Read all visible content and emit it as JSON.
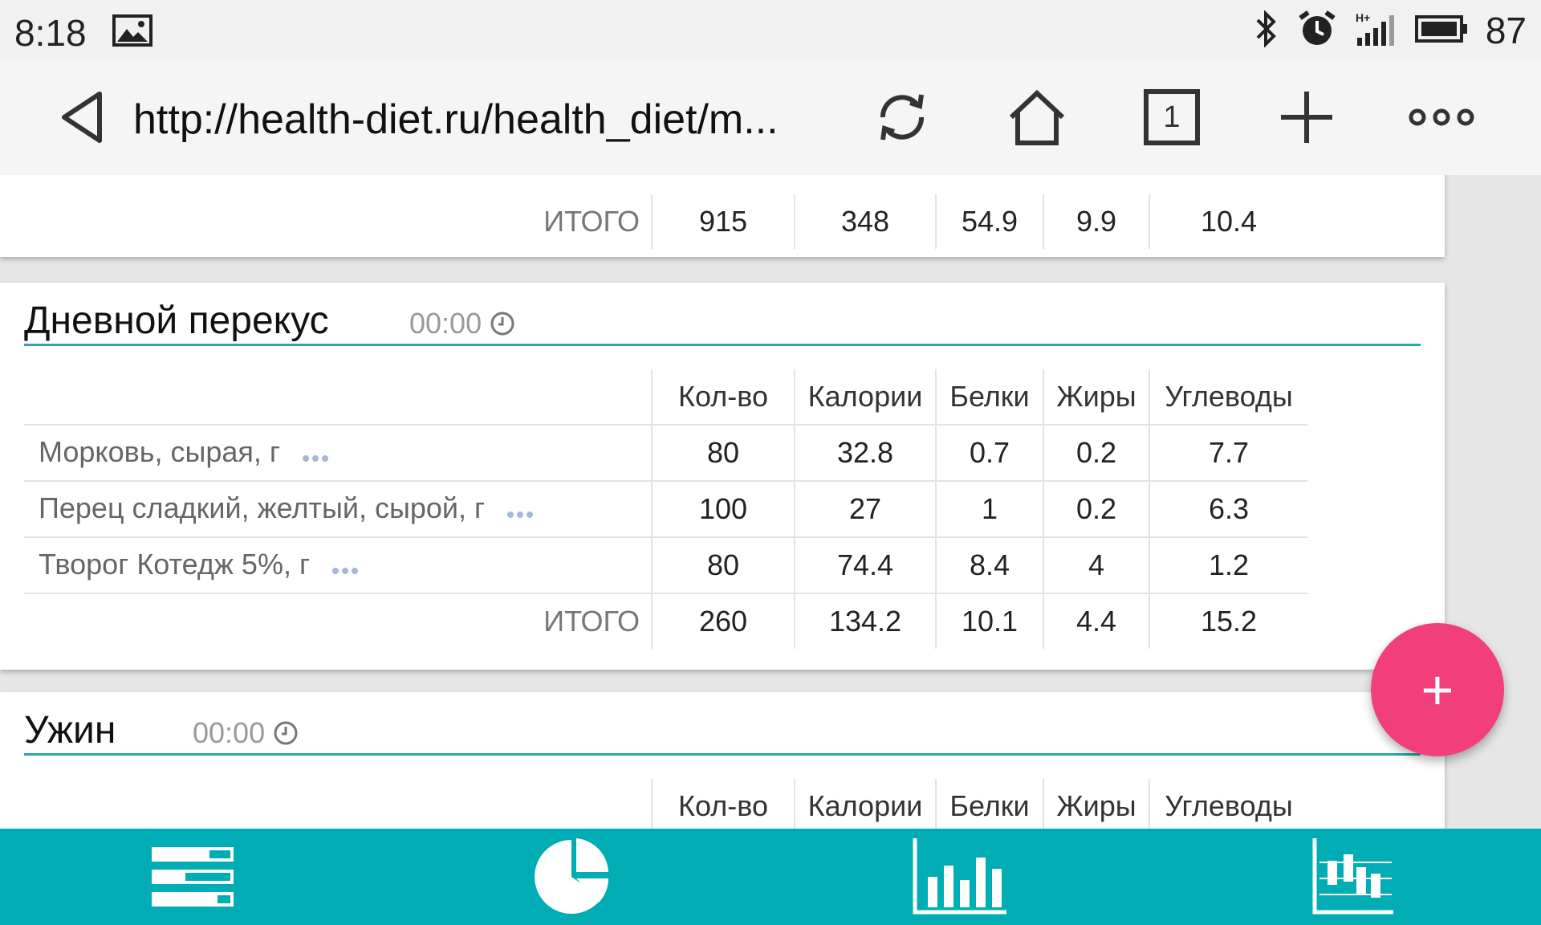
{
  "status": {
    "time": "8:18",
    "battery_level": "87",
    "icons": [
      "image-icon",
      "bluetooth-icon",
      "alarm-icon",
      "signal-icon",
      "battery-icon"
    ]
  },
  "browser": {
    "url": "http://health-diet.ru/health_diet/m...",
    "tab_count": "1",
    "icons": [
      "back-icon",
      "reload-icon",
      "home-icon",
      "tabs-icon",
      "new-tab-icon",
      "menu-icon"
    ]
  },
  "columns": {
    "qty": "Кол-во",
    "cal": "Калории",
    "prot": "Белки",
    "fat": "Жиры",
    "carb": "Углеводы"
  },
  "prev_meal": {
    "total": {
      "label": "ИТОГО",
      "qty": "915",
      "cal": "348",
      "prot": "54.9",
      "fat": "9.9",
      "carb": "10.4"
    }
  },
  "snack": {
    "title": "Дневной перекус",
    "time": "00:00",
    "rows": [
      {
        "name": "Морковь, сырая, г",
        "qty": "80",
        "cal": "32.8",
        "prot": "0.7",
        "fat": "0.2",
        "carb": "7.7"
      },
      {
        "name": "Перец сладкий, желтый, сырой, г",
        "qty": "100",
        "cal": "27",
        "prot": "1",
        "fat": "0.2",
        "carb": "6.3"
      },
      {
        "name": "Творог Котедж 5%, г",
        "qty": "80",
        "cal": "74.4",
        "prot": "8.4",
        "fat": "4",
        "carb": "1.2"
      }
    ],
    "total": {
      "label": "ИТОГО",
      "qty": "260",
      "cal": "134.2",
      "prot": "10.1",
      "fat": "4.4",
      "carb": "15.2"
    }
  },
  "dinner": {
    "title": "Ужин",
    "time": "00:00"
  },
  "fab": {
    "label": "+"
  },
  "colors": {
    "accent": "#00adb5",
    "divider": "#2aa6a6",
    "fab": "#f33e7c"
  }
}
